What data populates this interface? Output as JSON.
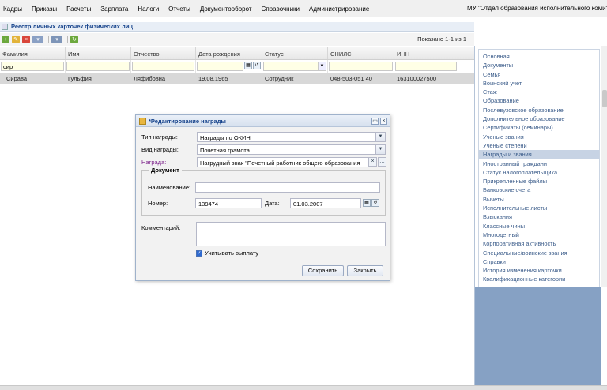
{
  "menu": {
    "items": [
      "Кадры",
      "Приказы",
      "Расчеты",
      "Зарплата",
      "Налоги",
      "Отчеты",
      "Документооборот",
      "Справочники",
      "Администрирование"
    ],
    "org_name": "МУ \"Отдел образования исполнительного комите"
  },
  "panel": {
    "title": "Реестр личных карточек физических лиц",
    "shown": "Показано 1-1 из 1"
  },
  "toolbar": {
    "add_icon": "add-icon",
    "edit_icon": "edit-icon",
    "delete_icon": "delete-icon",
    "dropdown_icon": "menu-dropdown-icon",
    "print_icon": "print-icon",
    "refresh_icon": "refresh-icon"
  },
  "grid": {
    "columns": [
      "Фамилия",
      "Имя",
      "Отчество",
      "Дата рождения",
      "Статус",
      "СНИЛС",
      "ИНН"
    ],
    "filters": {
      "surname": "сир"
    },
    "rows": [
      {
        "surname": "Сирава",
        "name": "Гульфия",
        "patronymic": "Ляфибовна",
        "birth_date": "19.08.1965",
        "status": "Сотрудник",
        "snils": "048-503-051 40",
        "inn": "163100027500"
      }
    ]
  },
  "right_panel": {
    "items": [
      "Основная",
      "Документы",
      "Семья",
      "Воинский учет",
      "Стаж",
      "Образование",
      "Послевузовское образование",
      "Дополнительное образование",
      "Сертификаты (семинары)",
      "Ученые звания",
      "Ученые степени",
      "Награды и звания",
      "Иностранный граждани",
      "Статус налогоплательщика",
      "Прикрепленные файлы",
      "Банковские счета",
      "Вычеты",
      "Исполнительные листы",
      "Взыскания",
      "Классные чины",
      "Многодетный",
      "Корпоративная активность",
      "Специальные/воинские звания",
      "Справки",
      "История изменения карточки",
      "Квалификационные категории"
    ],
    "active_index": 11
  },
  "dialog": {
    "title": "*Редактирование награды",
    "award_type_label": "Тип награды:",
    "award_type_value": "Награды по ОКИН",
    "award_kind_label": "Вид награды:",
    "award_kind_value": "Почетная грамота",
    "award_label": "Награда:",
    "award_value": "Нагрудный знак \"Почетный работник общего образования",
    "document_legend": "Документ",
    "doc_name_label": "Наименование:",
    "doc_name_value": "",
    "doc_number_label": "Номер:",
    "doc_number_value": "139474",
    "doc_date_label": "Дата:",
    "doc_date_value": "01.03.2007",
    "comment_label": "Комментарий:",
    "comment_value": "",
    "payment_checkbox_label": "Учитывать выплату",
    "payment_checked": true,
    "save_label": "Сохранить",
    "close_label": "Закрыть"
  }
}
